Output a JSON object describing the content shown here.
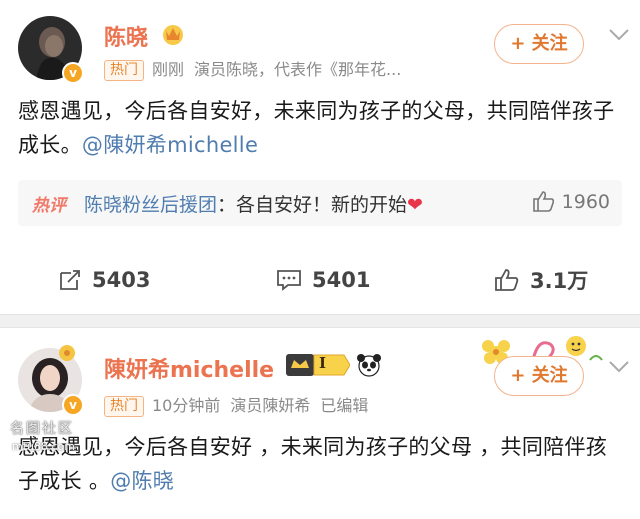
{
  "post1": {
    "author": "陈晓",
    "hot_tag": "热门",
    "time": "刚刚",
    "source": "演员陈晓，代表作《那年花...",
    "follow_label": "+ 关注",
    "text_before": "感恩遇见，今后各自安好，未来同为孩子的父母，共同陪伴孩子成长。",
    "mention": "@陳妍希michelle",
    "hot_comment": {
      "label": "热评",
      "commenter": "陈晓粉丝后援团",
      "text": "：各自安好！新的开始",
      "heart": "❤",
      "likes": "1960"
    },
    "reposts": "5403",
    "comments": "5401",
    "likes": "3.1万"
  },
  "post2": {
    "author": "陳妍希michelle",
    "level_badge": "I",
    "hot_tag": "热门",
    "time": "10分钟前",
    "source": "演员陳妍希",
    "edited": "已编辑",
    "follow_label": "+ 关注",
    "text_before": "感恩遇见，今后各自安好 ，未来同为孩子的父母 ，共同陪伴孩子成长 。",
    "mention": "@陈晓"
  },
  "watermark": {
    "line1": "名图社区",
    "line2": "mtu88.com"
  },
  "colors": {
    "name": "#eb7350",
    "link": "#507daf",
    "hot": "#e8862f"
  }
}
